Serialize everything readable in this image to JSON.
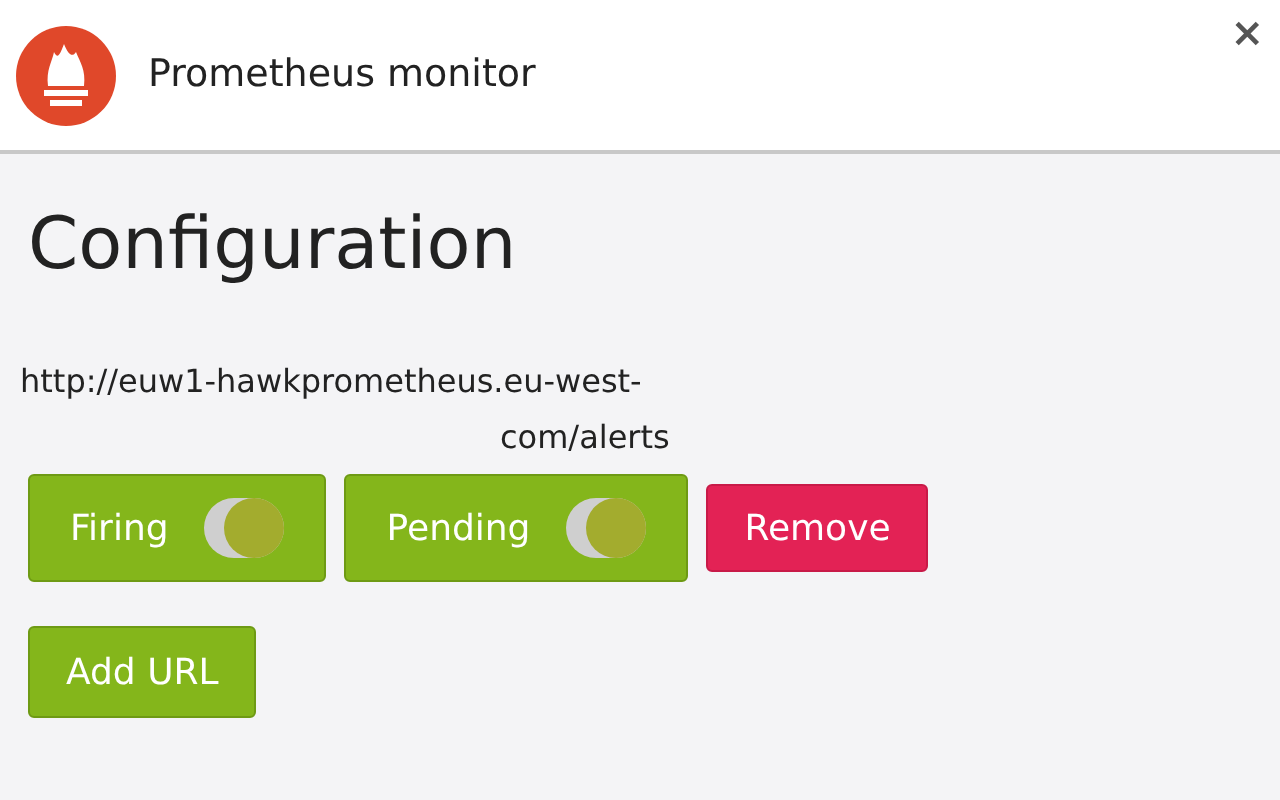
{
  "header": {
    "title": "Prometheus monitor",
    "close": "×"
  },
  "page": {
    "heading": "Configuration",
    "url_lines": [
      "http://euw1-hawkprometheus.eu-west-",
      "com/alerts"
    ],
    "toggles": [
      {
        "label": "Firing",
        "on": true
      },
      {
        "label": "Pending",
        "on": true
      }
    ],
    "remove_button": "Remove",
    "add_button": "Add URL"
  }
}
